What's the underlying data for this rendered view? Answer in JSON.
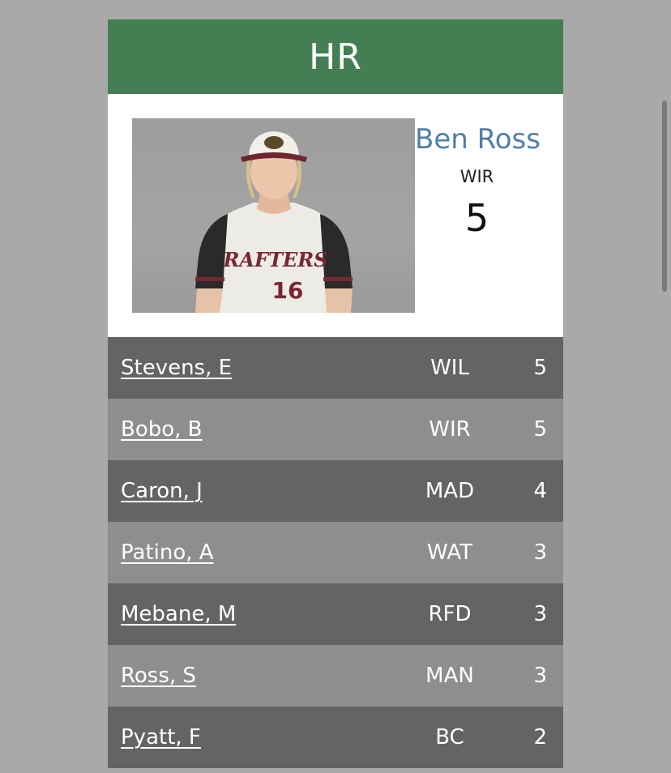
{
  "header": {
    "title": "HR"
  },
  "leader": {
    "name": "Ben Ross",
    "team": "WIR",
    "value": "5",
    "photo": {
      "jersey_text": "RAFTERS",
      "jersey_number": "16"
    }
  },
  "rows": [
    {
      "name": "Stevens, E",
      "team": "WIL",
      "value": "5"
    },
    {
      "name": "Bobo, B",
      "team": "WIR",
      "value": "5"
    },
    {
      "name": "Caron, J",
      "team": "MAD",
      "value": "4"
    },
    {
      "name": "Patino, A",
      "team": "WAT",
      "value": "3"
    },
    {
      "name": "Mebane, M",
      "team": "RFD",
      "value": "3"
    },
    {
      "name": "Ross, S",
      "team": "MAN",
      "value": "3"
    },
    {
      "name": "Pyatt, F",
      "team": "BC",
      "value": "2"
    }
  ],
  "colors": {
    "header_bg": "#437f52",
    "name_link": "#4f7ea8",
    "row_dark": "#646464",
    "row_light": "#8e8e8e"
  }
}
